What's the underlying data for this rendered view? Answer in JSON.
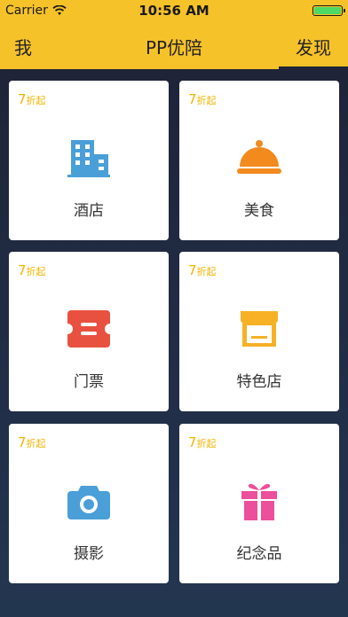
{
  "status_bar": {
    "carrier": "Carrier",
    "time": "10:56 AM"
  },
  "nav": {
    "left_label": "我",
    "title": "PP优陪",
    "right_label": "发现"
  },
  "colors": {
    "accent": "#f6c229",
    "background": "#1f2438",
    "badge": "#f4b400"
  },
  "cards": [
    {
      "badge_num": "7",
      "badge_text": "折起",
      "label": "酒店",
      "icon": "hotel-icon"
    },
    {
      "badge_num": "7",
      "badge_text": "折起",
      "label": "美食",
      "icon": "food-cloche-icon"
    },
    {
      "badge_num": "7",
      "badge_text": "折起",
      "label": "门票",
      "icon": "ticket-icon"
    },
    {
      "badge_num": "7",
      "badge_text": "折起",
      "label": "特色店",
      "icon": "store-icon"
    },
    {
      "badge_num": "7",
      "badge_text": "折起",
      "label": "摄影",
      "icon": "camera-icon"
    },
    {
      "badge_num": "7",
      "badge_text": "折起",
      "label": "纪念品",
      "icon": "gift-icon"
    }
  ]
}
